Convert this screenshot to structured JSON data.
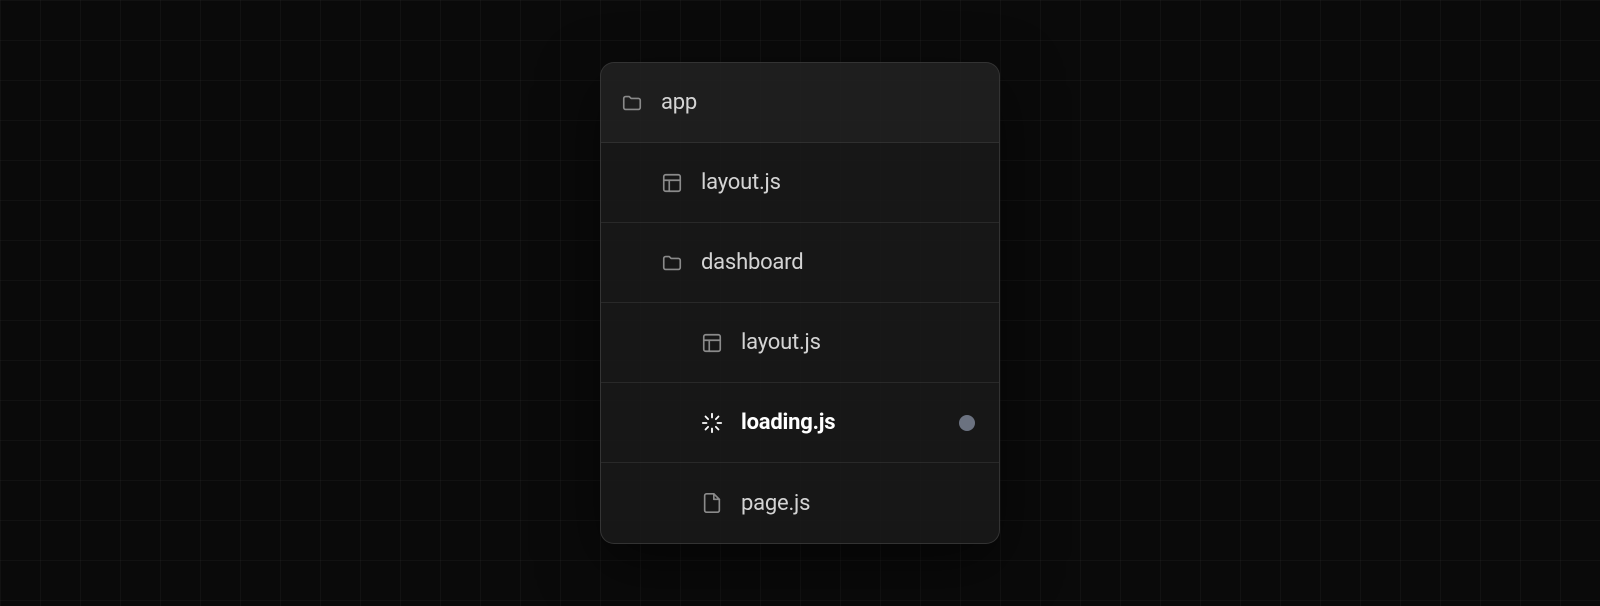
{
  "tree": {
    "root": {
      "label": "app",
      "icon": "folder"
    },
    "items": [
      {
        "label": "layout.js",
        "icon": "layout",
        "indent": 1,
        "highlighted": false
      },
      {
        "label": "dashboard",
        "icon": "folder",
        "indent": 1,
        "highlighted": false
      },
      {
        "label": "layout.js",
        "icon": "layout",
        "indent": 2,
        "highlighted": false
      },
      {
        "label": "loading.js",
        "icon": "spinner",
        "indent": 2,
        "highlighted": true,
        "indicator": true
      },
      {
        "label": "page.js",
        "icon": "file",
        "indent": 2,
        "highlighted": false
      }
    ]
  }
}
